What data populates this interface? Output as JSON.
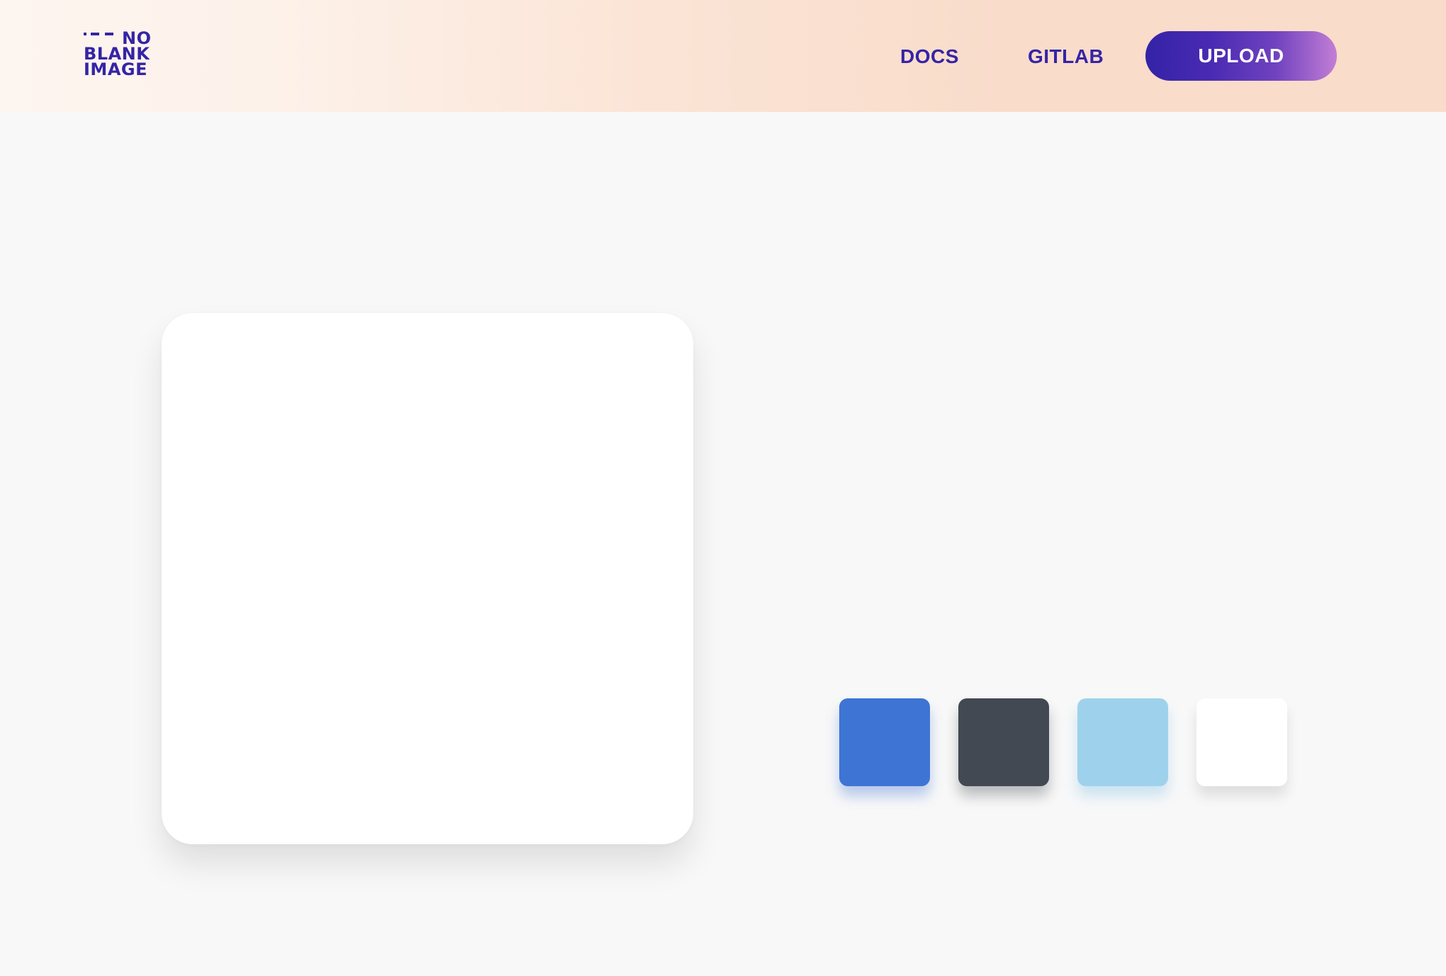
{
  "logo": {
    "line1": "NO",
    "line2": "BLANK",
    "line3": "IMAGE"
  },
  "nav": {
    "docs": "DOCS",
    "gitlab": "GITLAB",
    "upload": "UPLOAD"
  },
  "theme": {
    "brand": "#3524a6",
    "background": "#f8f8f8",
    "header_gradient": [
      "#fdf5f0",
      "#f9dcc9"
    ],
    "upload_gradient": [
      "#3422a6",
      "#c27ed5"
    ]
  },
  "swatches": [
    {
      "name": "blue",
      "color": "#3e74d4",
      "shadow": "rgba(62,116,212,0.35)"
    },
    {
      "name": "charcoal",
      "color": "#424953",
      "shadow": "rgba(30,35,45,0.28)"
    },
    {
      "name": "light-blue",
      "color": "#9ed2ec",
      "shadow": "rgba(120,190,230,0.35)"
    },
    {
      "name": "white",
      "color": "#ffffff",
      "shadow": "rgba(0,0,0,0.10)"
    }
  ]
}
